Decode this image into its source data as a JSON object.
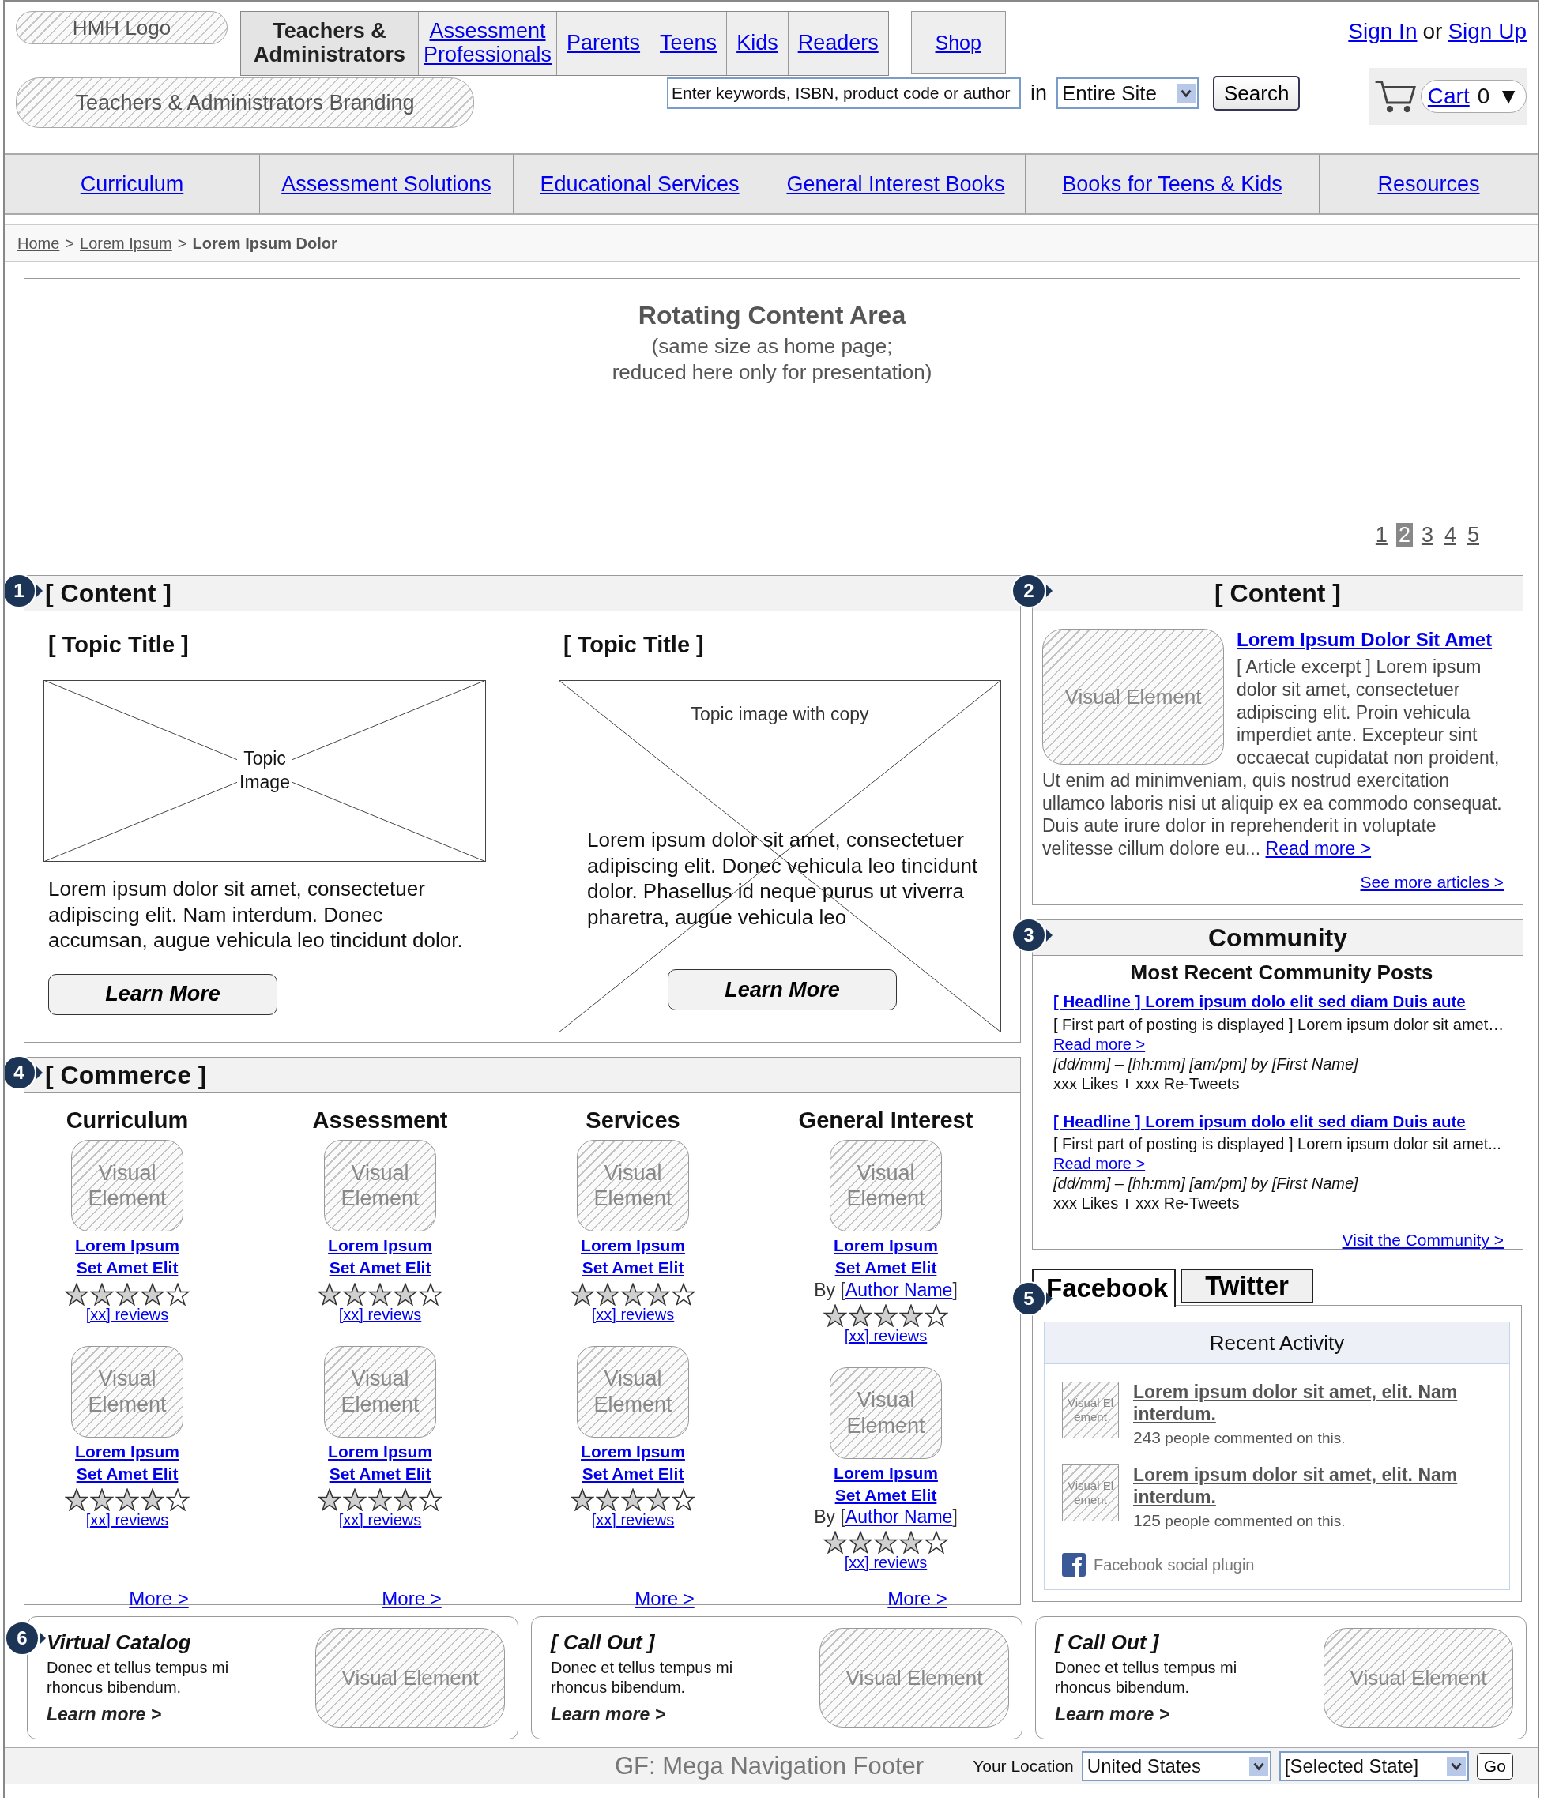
{
  "header": {
    "logo": "HMH Logo",
    "branding": "Teachers & Administrators Branding",
    "audience_tabs": [
      {
        "label": "Teachers & Administrators",
        "selected": true
      },
      {
        "label": "Assessment Professionals",
        "selected": false
      },
      {
        "label": "Parents",
        "selected": false
      },
      {
        "label": "Teens",
        "selected": false
      },
      {
        "label": "Kids",
        "selected": false
      },
      {
        "label": "Readers",
        "selected": false
      }
    ],
    "shop": "Shop",
    "account": {
      "sign_in": "Sign In",
      "separator": "or",
      "sign_up": "Sign Up"
    },
    "search": {
      "placeholder": "Enter keywords, ISBN, product code or author",
      "scope_label": "in",
      "scope": "Entire Site",
      "button": "Search"
    },
    "cart": {
      "label": "Cart",
      "count": "0",
      "caret": "▼"
    }
  },
  "main_nav": [
    "Curriculum",
    "Assessment Solutions",
    "Educational Services",
    "General Interest Books",
    "Books for Teens & Kids",
    "Resources"
  ],
  "breadcrumb": [
    {
      "label": "Home",
      "kind": "link"
    },
    {
      "label": ">",
      "kind": "separator"
    },
    {
      "label": "Lorem Ipsum",
      "kind": "link"
    },
    {
      "label": ">",
      "kind": "separator"
    },
    {
      "label": "Lorem Ipsum Dolor",
      "kind": "current"
    }
  ],
  "rotating": {
    "title": "Rotating Content Area",
    "note_lines": [
      "(same size as home page;",
      "reduced here only for presentation)"
    ],
    "pages": [
      {
        "label": "1",
        "selected": false
      },
      {
        "label": "2",
        "selected": true
      },
      {
        "label": "3",
        "selected": false
      },
      {
        "label": "4",
        "selected": false
      },
      {
        "label": "5",
        "selected": false
      }
    ]
  },
  "content_main": {
    "marker": "1",
    "title": "[ Content ]",
    "topics": [
      {
        "kind": "image_above",
        "title": "[ Topic Title ]",
        "image_label": "Topic Image",
        "text": "Lorem ipsum dolor sit amet, consectetuer adipiscing elit. Nam interdum. Donec accumsan, augue vehicula leo tincidunt dolor.",
        "button": "Learn More"
      },
      {
        "kind": "image_behind",
        "title": "[ Topic Title ]",
        "image_label": "Topic image with copy",
        "text": "Lorem ipsum dolor sit amet, consectetuer adipiscing elit. Donec vehicula leo tincidunt dolor. Phasellus id neque purus ut viverra pharetra, augue vehicula leo",
        "button": "Learn More"
      }
    ]
  },
  "content_side": {
    "marker": "2",
    "title": "[ Content ]",
    "visual": "Visual Element",
    "headline": "Lorem Ipsum Dolor Sit Amet",
    "excerpt": "[ Article excerpt ] Lorem ipsum dolor sit amet, consectetuer adipiscing elit. Proin vehicula imperdiet ante. Excepteur sint occaecat cupidatat non proident,",
    "excerpt_more": "Ut enim ad minimveniam, quis nostrud exercitation ullamco laboris nisi ut aliquip ex ea commodo consequat. Duis aute irure dolor in reprehenderit in voluptate velitesse cillum dolore eu...",
    "read_more": "Read more >",
    "see_more": "See more articles >"
  },
  "community": {
    "marker": "3",
    "title": "Community",
    "subtitle": "Most Recent Community Posts",
    "posts": [
      {
        "headline": "[ Headline ] Lorem ipsum dolo elit sed diam Duis aute",
        "excerpt": "[ First part of posting is displayed ] Lorem ipsum dolor sit amet…",
        "read_more": "Read more >",
        "meta": "[dd/mm] – [hh:mm] [am/pm] by [First Name]",
        "likes": "xxx Likes",
        "retweets": "xxx Re-Tweets"
      },
      {
        "headline": "[ Headline ] Lorem ipsum dolo elit sed diam Duis aute",
        "excerpt": "[ First part of posting is displayed ] Lorem ipsum dolor sit amet...",
        "read_more": "Read more >",
        "meta": "[dd/mm] – [hh:mm] [am/pm] by [First Name]",
        "likes": "xxx Likes",
        "retweets": "xxx Re-Tweets"
      }
    ],
    "visit": "Visit the Community >"
  },
  "commerce": {
    "marker": "4",
    "title": "[ Commerce ]",
    "columns": [
      {
        "title": "Curriculum",
        "more": "More >",
        "products": [
          {
            "visual": "Visual Element",
            "name": "Lorem Ipsum Set Amet Elit",
            "stars": 4,
            "reviews": "[xx] reviews"
          },
          {
            "visual": "Visual Element",
            "name": "Lorem Ipsum Set Amet Elit",
            "stars": 4,
            "reviews": "[xx] reviews"
          }
        ]
      },
      {
        "title": "Assessment",
        "more": "More >",
        "products": [
          {
            "visual": "Visual Element",
            "name": "Lorem Ipsum Set Amet Elit",
            "stars": 4,
            "reviews": "[xx] reviews"
          },
          {
            "visual": "Visual Element",
            "name": "Lorem Ipsum Set Amet Elit",
            "stars": 4,
            "reviews": "[xx] reviews"
          }
        ]
      },
      {
        "title": "Services",
        "more": "More >",
        "products": [
          {
            "visual": "Visual Element",
            "name": "Lorem Ipsum Set Amet Elit",
            "stars": 4,
            "reviews": "[xx] reviews"
          },
          {
            "visual": "Visual Element",
            "name": "Lorem Ipsum Set Amet Elit",
            "stars": 4,
            "reviews": "[xx] reviews"
          }
        ]
      },
      {
        "title": "General Interest",
        "more": "More >",
        "products": [
          {
            "visual": "Visual Element",
            "name": "Lorem Ipsum Set Amet Elit",
            "by": "By [",
            "author": "Author Name",
            "by_end": "]",
            "stars": 4,
            "reviews": "[xx] reviews"
          },
          {
            "visual": "Visual Element",
            "name": "Lorem Ipsum Set Amet Elit",
            "by": "By [",
            "author": "Author Name",
            "by_end": "]",
            "stars": 4,
            "reviews": "[xx] reviews"
          }
        ]
      }
    ]
  },
  "social": {
    "marker": "5",
    "tabs": [
      {
        "label": "Facebook",
        "selected": true
      },
      {
        "label": "Twitter",
        "selected": false
      }
    ],
    "heading": "Recent Activity",
    "items": [
      {
        "visual": "Visual Element",
        "title": "Lorem ipsum dolor sit amet, elit. Nam interdum.",
        "count": "243",
        "comment": "people commented on this."
      },
      {
        "visual": "Visual Element",
        "title": "Lorem ipsum dolor sit amet, elit. Nam interdum.",
        "count": "125",
        "comment": "people commented on this."
      }
    ],
    "plugin": "Facebook social plugin"
  },
  "callouts": {
    "marker": "6",
    "items": [
      {
        "title": "Virtual Catalog",
        "text": "Donec et tellus tempus mi rhoncus bibendum.",
        "link": "Learn more >",
        "visual": "Visual Element"
      },
      {
        "title": "[ Call Out ]",
        "text": "Donec et tellus tempus mi rhoncus bibendum.",
        "link": "Learn more >",
        "visual": "Visual Element"
      },
      {
        "title": "[ Call Out ]",
        "text": "Donec et tellus tempus mi rhoncus bibendum.",
        "link": "Learn more >",
        "visual": "Visual Element"
      }
    ]
  },
  "footer": {
    "title": "GF: Mega Navigation Footer",
    "location_label": "Your Location",
    "country": "United States",
    "state": "[Selected State]",
    "button": "Go"
  }
}
